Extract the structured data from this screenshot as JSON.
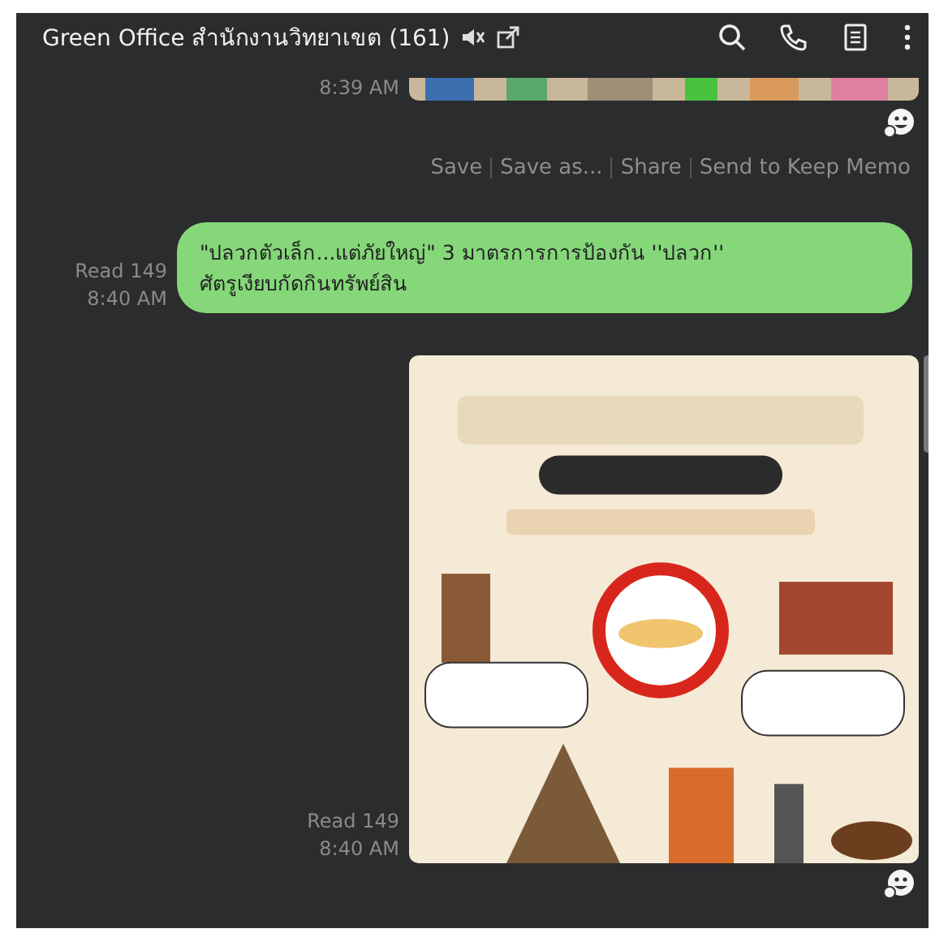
{
  "header": {
    "title": "Green Office สำนักงานวิทยาเขต (161)",
    "muted": true
  },
  "messages": [
    {
      "time": "8:39 AM",
      "cut": true
    },
    {
      "kind": "actions",
      "actions": [
        "Save",
        "Save as...",
        "Share",
        "Send to Keep Memo"
      ]
    },
    {
      "kind": "text",
      "read": "Read 149",
      "time": "8:40 AM",
      "text": "\"ปลวกตัวเล็ก...แต่ภัยใหญ่\" 3  มาตรการการป้องกัน ''ปลวก''\nศัตรูเงียบกัดกินทรัพย์สิน"
    },
    {
      "read": "Read 149",
      "time": "8:40 AM",
      "cut": false
    }
  ]
}
